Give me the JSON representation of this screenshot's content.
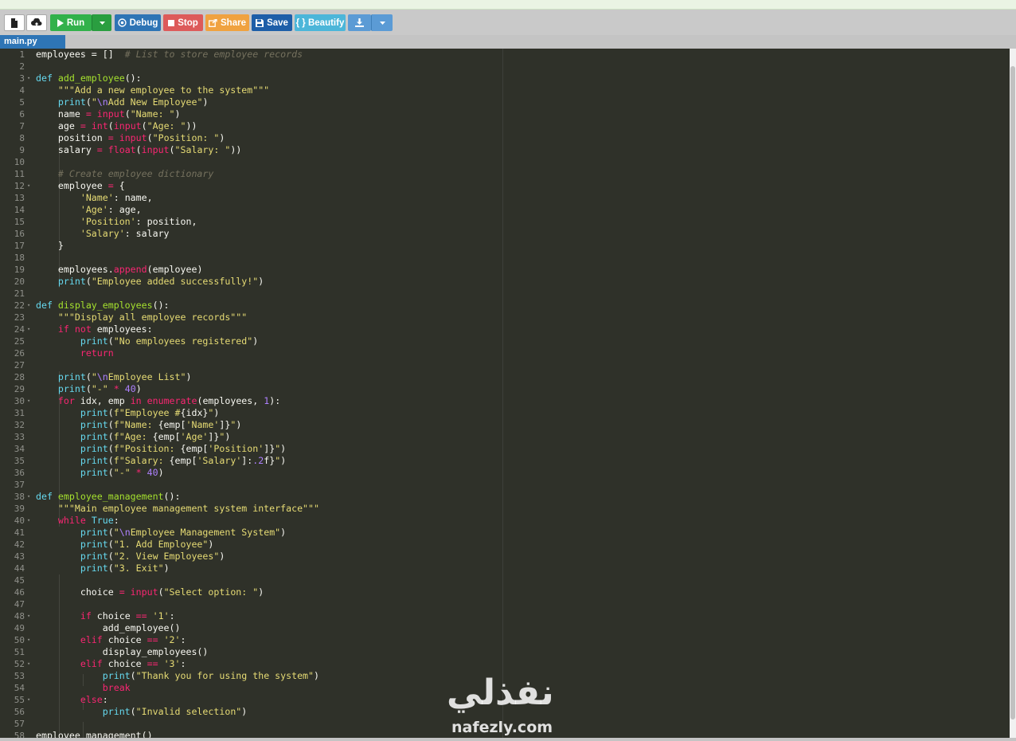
{
  "toolbar": {
    "run_label": "Run",
    "debug_label": "Debug",
    "stop_label": "Stop",
    "share_label": "Share",
    "save_label": "Save",
    "beautify_label": "{ } Beautify"
  },
  "tab": {
    "filename": "main.py"
  },
  "watermark": {
    "arabic": "نفذلي",
    "latin": "nafezly.com"
  },
  "colors": {
    "keyword": "#f92672",
    "function": "#a6e22e",
    "string": "#e6db74",
    "comment": "#75715e",
    "number": "#ae81ff",
    "builtin_const": "#66d9ef",
    "background": "#2f3129"
  },
  "code_lines": [
    [
      [
        "employees = []  ",
        ""
      ],
      [
        "# List to store employee records",
        "cm"
      ]
    ],
    [],
    [
      [
        "def ",
        "bi"
      ],
      [
        "add_employee",
        "fn"
      ],
      [
        "():",
        ""
      ]
    ],
    [
      [
        "    ",
        ""
      ],
      [
        "\"\"\"Add a new employee to the system\"\"\"",
        "st"
      ]
    ],
    [
      [
        "    ",
        ""
      ],
      [
        "print",
        "bi"
      ],
      [
        "(",
        ""
      ],
      [
        "\"",
        "st"
      ],
      [
        "\\n",
        "sp"
      ],
      [
        "Add New Employee\"",
        "st"
      ],
      [
        ")",
        ""
      ]
    ],
    [
      [
        "    name ",
        ""
      ],
      [
        "=",
        "kw"
      ],
      [
        " ",
        ""
      ],
      [
        "input",
        "kw"
      ],
      [
        "(",
        ""
      ],
      [
        "\"Name: \"",
        "st"
      ],
      [
        ")",
        ""
      ]
    ],
    [
      [
        "    age ",
        ""
      ],
      [
        "=",
        "kw"
      ],
      [
        " ",
        ""
      ],
      [
        "int",
        "kw"
      ],
      [
        "(",
        ""
      ],
      [
        "input",
        "kw"
      ],
      [
        "(",
        ""
      ],
      [
        "\"Age: \"",
        "st"
      ],
      [
        "))",
        ""
      ]
    ],
    [
      [
        "    position ",
        ""
      ],
      [
        "=",
        "kw"
      ],
      [
        " ",
        ""
      ],
      [
        "input",
        "kw"
      ],
      [
        "(",
        ""
      ],
      [
        "\"Position: \"",
        "st"
      ],
      [
        ")",
        ""
      ]
    ],
    [
      [
        "    salary ",
        ""
      ],
      [
        "=",
        "kw"
      ],
      [
        " ",
        ""
      ],
      [
        "float",
        "kw"
      ],
      [
        "(",
        ""
      ],
      [
        "input",
        "kw"
      ],
      [
        "(",
        ""
      ],
      [
        "\"Salary: \"",
        "st"
      ],
      [
        "))",
        ""
      ]
    ],
    [],
    [
      [
        "    ",
        ""
      ],
      [
        "# Create employee dictionary",
        "cm"
      ]
    ],
    [
      [
        "    employee ",
        ""
      ],
      [
        "=",
        "kw"
      ],
      [
        " {",
        ""
      ]
    ],
    [
      [
        "        ",
        ""
      ],
      [
        "'Name'",
        "st"
      ],
      [
        ": name,",
        ""
      ]
    ],
    [
      [
        "        ",
        ""
      ],
      [
        "'Age'",
        "st"
      ],
      [
        ": age,",
        ""
      ]
    ],
    [
      [
        "        ",
        ""
      ],
      [
        "'Position'",
        "st"
      ],
      [
        ": position,",
        ""
      ]
    ],
    [
      [
        "        ",
        ""
      ],
      [
        "'Salary'",
        "st"
      ],
      [
        ": salary",
        ""
      ]
    ],
    [
      [
        "    }",
        ""
      ]
    ],
    [],
    [
      [
        "    employees.",
        ""
      ],
      [
        "append",
        "kw"
      ],
      [
        "(employee)",
        ""
      ]
    ],
    [
      [
        "    ",
        ""
      ],
      [
        "print",
        "bi"
      ],
      [
        "(",
        ""
      ],
      [
        "\"Employee added successfully!\"",
        "st"
      ],
      [
        ")",
        ""
      ]
    ],
    [],
    [
      [
        "def ",
        "bi"
      ],
      [
        "display_employees",
        "fn"
      ],
      [
        "():",
        ""
      ]
    ],
    [
      [
        "    ",
        ""
      ],
      [
        "\"\"\"Display all employee records\"\"\"",
        "st"
      ]
    ],
    [
      [
        "    ",
        ""
      ],
      [
        "if not",
        "kw"
      ],
      [
        " employees:",
        ""
      ]
    ],
    [
      [
        "        ",
        ""
      ],
      [
        "print",
        "bi"
      ],
      [
        "(",
        ""
      ],
      [
        "\"No employees registered\"",
        "st"
      ],
      [
        ")",
        ""
      ]
    ],
    [
      [
        "        ",
        ""
      ],
      [
        "return",
        "kw"
      ]
    ],
    [],
    [
      [
        "    ",
        ""
      ],
      [
        "print",
        "bi"
      ],
      [
        "(",
        ""
      ],
      [
        "\"",
        "st"
      ],
      [
        "\\n",
        "sp"
      ],
      [
        "Employee List\"",
        "st"
      ],
      [
        ")",
        ""
      ]
    ],
    [
      [
        "    ",
        ""
      ],
      [
        "print",
        "bi"
      ],
      [
        "(",
        ""
      ],
      [
        "\"-\"",
        "st"
      ],
      [
        " ",
        ""
      ],
      [
        "*",
        "kw"
      ],
      [
        " ",
        ""
      ],
      [
        "40",
        "nm"
      ],
      [
        ")",
        ""
      ]
    ],
    [
      [
        "    ",
        ""
      ],
      [
        "for",
        "kw"
      ],
      [
        " idx, emp ",
        ""
      ],
      [
        "in",
        "kw"
      ],
      [
        " ",
        ""
      ],
      [
        "enumerate",
        "kw"
      ],
      [
        "(employees, ",
        ""
      ],
      [
        "1",
        "nm"
      ],
      [
        "):",
        ""
      ]
    ],
    [
      [
        "        ",
        ""
      ],
      [
        "print",
        "bi"
      ],
      [
        "(",
        ""
      ],
      [
        "f\"Employee #",
        "st"
      ],
      [
        "{idx}",
        ""
      ],
      [
        "\"",
        "st"
      ],
      [
        ")",
        ""
      ]
    ],
    [
      [
        "        ",
        ""
      ],
      [
        "print",
        "bi"
      ],
      [
        "(",
        ""
      ],
      [
        "f\"Name: ",
        "st"
      ],
      [
        "{emp[",
        ""
      ],
      [
        "'Name'",
        "st"
      ],
      [
        "]}",
        ""
      ],
      [
        "\"",
        "st"
      ],
      [
        ")",
        ""
      ]
    ],
    [
      [
        "        ",
        ""
      ],
      [
        "print",
        "bi"
      ],
      [
        "(",
        ""
      ],
      [
        "f\"Age: ",
        "st"
      ],
      [
        "{emp[",
        ""
      ],
      [
        "'Age'",
        "st"
      ],
      [
        "]}",
        ""
      ],
      [
        "\"",
        "st"
      ],
      [
        ")",
        ""
      ]
    ],
    [
      [
        "        ",
        ""
      ],
      [
        "print",
        "bi"
      ],
      [
        "(",
        ""
      ],
      [
        "f\"Position: ",
        "st"
      ],
      [
        "{emp[",
        ""
      ],
      [
        "'Position'",
        "st"
      ],
      [
        "]}",
        ""
      ],
      [
        "\"",
        "st"
      ],
      [
        ")",
        ""
      ]
    ],
    [
      [
        "        ",
        ""
      ],
      [
        "print",
        "bi"
      ],
      [
        "(",
        ""
      ],
      [
        "f\"Salary: ",
        "st"
      ],
      [
        "{emp[",
        ""
      ],
      [
        "'Salary'",
        "st"
      ],
      [
        "]:",
        ""
      ],
      [
        ".2",
        "nm"
      ],
      [
        "f}",
        ""
      ],
      [
        "\"",
        "st"
      ],
      [
        ")",
        ""
      ]
    ],
    [
      [
        "        ",
        ""
      ],
      [
        "print",
        "bi"
      ],
      [
        "(",
        ""
      ],
      [
        "\"-\"",
        "st"
      ],
      [
        " ",
        ""
      ],
      [
        "*",
        "kw"
      ],
      [
        " ",
        ""
      ],
      [
        "40",
        "nm"
      ],
      [
        ")",
        ""
      ]
    ],
    [],
    [
      [
        "def ",
        "bi"
      ],
      [
        "employee_management",
        "fn"
      ],
      [
        "():",
        ""
      ]
    ],
    [
      [
        "    ",
        ""
      ],
      [
        "\"\"\"Main employee management system interface\"\"\"",
        "st"
      ]
    ],
    [
      [
        "    ",
        ""
      ],
      [
        "while",
        "kw"
      ],
      [
        " ",
        ""
      ],
      [
        "True",
        "bi"
      ],
      [
        ":",
        ""
      ]
    ],
    [
      [
        "        ",
        ""
      ],
      [
        "print",
        "bi"
      ],
      [
        "(",
        ""
      ],
      [
        "\"",
        "st"
      ],
      [
        "\\n",
        "sp"
      ],
      [
        "Employee Management System\"",
        "st"
      ],
      [
        ")",
        ""
      ]
    ],
    [
      [
        "        ",
        ""
      ],
      [
        "print",
        "bi"
      ],
      [
        "(",
        ""
      ],
      [
        "\"1. Add Employee\"",
        "st"
      ],
      [
        ")",
        ""
      ]
    ],
    [
      [
        "        ",
        ""
      ],
      [
        "print",
        "bi"
      ],
      [
        "(",
        ""
      ],
      [
        "\"2. View Employees\"",
        "st"
      ],
      [
        ")",
        ""
      ]
    ],
    [
      [
        "        ",
        ""
      ],
      [
        "print",
        "bi"
      ],
      [
        "(",
        ""
      ],
      [
        "\"3. Exit\"",
        "st"
      ],
      [
        ")",
        ""
      ]
    ],
    [],
    [
      [
        "        choice ",
        ""
      ],
      [
        "=",
        "kw"
      ],
      [
        " ",
        ""
      ],
      [
        "input",
        "kw"
      ],
      [
        "(",
        ""
      ],
      [
        "\"Select option: \"",
        "st"
      ],
      [
        ")",
        ""
      ]
    ],
    [],
    [
      [
        "        ",
        ""
      ],
      [
        "if",
        "kw"
      ],
      [
        " choice ",
        ""
      ],
      [
        "==",
        "kw"
      ],
      [
        " ",
        ""
      ],
      [
        "'1'",
        "st"
      ],
      [
        ":",
        ""
      ]
    ],
    [
      [
        "            add_employee()",
        ""
      ]
    ],
    [
      [
        "        ",
        ""
      ],
      [
        "elif",
        "kw"
      ],
      [
        " choice ",
        ""
      ],
      [
        "==",
        "kw"
      ],
      [
        " ",
        ""
      ],
      [
        "'2'",
        "st"
      ],
      [
        ":",
        ""
      ]
    ],
    [
      [
        "            display_employees()",
        ""
      ]
    ],
    [
      [
        "        ",
        ""
      ],
      [
        "elif",
        "kw"
      ],
      [
        " choice ",
        ""
      ],
      [
        "==",
        "kw"
      ],
      [
        " ",
        ""
      ],
      [
        "'3'",
        "st"
      ],
      [
        ":",
        ""
      ]
    ],
    [
      [
        "            ",
        ""
      ],
      [
        "print",
        "bi"
      ],
      [
        "(",
        ""
      ],
      [
        "\"Thank you for using the system\"",
        "st"
      ],
      [
        ")",
        ""
      ]
    ],
    [
      [
        "            ",
        ""
      ],
      [
        "break",
        "kw"
      ]
    ],
    [
      [
        "        ",
        ""
      ],
      [
        "else",
        "kw"
      ],
      [
        ":",
        ""
      ]
    ],
    [
      [
        "            ",
        ""
      ],
      [
        "print",
        "bi"
      ],
      [
        "(",
        ""
      ],
      [
        "\"Invalid selection\"",
        "st"
      ],
      [
        ")",
        ""
      ]
    ],
    [],
    [
      [
        "employee_management()",
        ""
      ]
    ]
  ],
  "fold_lines": [
    3,
    12,
    22,
    24,
    30,
    38,
    40,
    48,
    50,
    52,
    55
  ]
}
